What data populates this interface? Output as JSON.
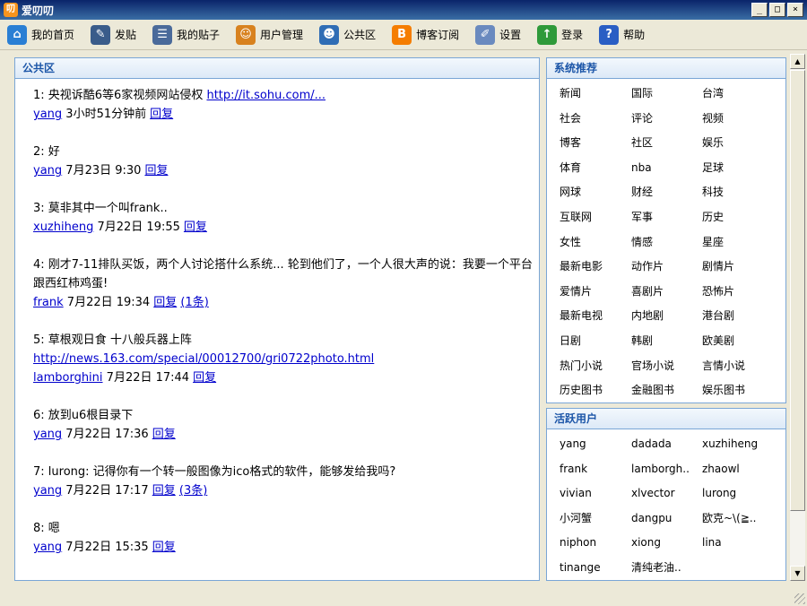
{
  "window": {
    "title": "爱叨叨",
    "logo_text": "叨",
    "min": "_",
    "max": "□",
    "close": "×"
  },
  "toolbar": [
    {
      "id": "home",
      "label": "我的首页",
      "icon": "house-icon",
      "glyph": "⌂",
      "color": "#2a7fd4"
    },
    {
      "id": "post",
      "label": "发贴",
      "icon": "pencil-paper-icon",
      "glyph": "✎",
      "color": "#3a5c8a"
    },
    {
      "id": "myposts",
      "label": "我的贴子",
      "icon": "speech-bubble-icon",
      "glyph": "☰",
      "color": "#4a6a9a"
    },
    {
      "id": "users",
      "label": "用户管理",
      "icon": "users-icon",
      "glyph": "☺",
      "color": "#d8821f"
    },
    {
      "id": "public",
      "label": "公共区",
      "icon": "group-icon",
      "glyph": "☻",
      "color": "#2f6db5"
    },
    {
      "id": "blog",
      "label": "博客订阅",
      "icon": "blogger-icon",
      "glyph": "B",
      "color": "#f57d00"
    },
    {
      "id": "settings",
      "label": "设置",
      "icon": "pen-edit-icon",
      "glyph": "✐",
      "color": "#6a8abf"
    },
    {
      "id": "login",
      "label": "登录",
      "icon": "arrow-up-icon",
      "glyph": "↑",
      "color": "#2f9a3a"
    },
    {
      "id": "help",
      "label": "帮助",
      "icon": "help-icon",
      "glyph": "?",
      "color": "#2a5ec4"
    }
  ],
  "public": {
    "title": "公共区",
    "posts": [
      {
        "text": "1: 央视诉酷6等6家视频网站侵权 ",
        "link": "http://it.sohu.com/...",
        "user": "yang",
        "time": "3小时51分钟前",
        "reply": "回复",
        "replies": ""
      },
      {
        "text": "2: 好",
        "link": "",
        "user": "yang",
        "time": "7月23日 9:30",
        "reply": "回复",
        "replies": ""
      },
      {
        "text": "3: 莫非其中一个叫frank..",
        "link": "",
        "user": "xuzhiheng",
        "time": "7月22日 19:55",
        "reply": "回复",
        "replies": ""
      },
      {
        "text": "4: 刚才7-11排队买饭，两个人讨论搭什么系统... 轮到他们了，一个人很大声的说：我要一个平台跟西红柿鸡蛋!",
        "link": "",
        "user": "frank",
        "time": "7月22日 19:34",
        "reply": "回复",
        "replies": "(1条)"
      },
      {
        "text": "5: 草根观日食 十八般兵器上阵",
        "link": "http://news.163.com/special/00012700/gri0722photo.html",
        "user": "lamborghini",
        "time": "7月22日 17:44",
        "reply": "回复",
        "replies": ""
      },
      {
        "text": "6: 放到u6根目录下",
        "link": "",
        "user": "yang",
        "time": "7月22日 17:36",
        "reply": "回复",
        "replies": ""
      },
      {
        "text": "7: lurong: 记得你有一个转一般图像为ico格式的软件，能够发给我吗?",
        "link": "",
        "user": "yang",
        "time": "7月22日 17:17",
        "reply": "回复",
        "replies": "(3条)"
      },
      {
        "text": "8: 嗯",
        "link": "",
        "user": "yang",
        "time": "7月22日 15:35",
        "reply": "回复",
        "replies": ""
      }
    ]
  },
  "recommend": {
    "title": "系统推荐",
    "items": [
      "新闻",
      "国际",
      "台湾",
      "社会",
      "评论",
      "视频",
      "博客",
      "社区",
      "娱乐",
      "体育",
      "nba",
      "足球",
      "网球",
      "财经",
      "科技",
      "互联网",
      "军事",
      "历史",
      "女性",
      "情感",
      "星座",
      "最新电影",
      "动作片",
      "剧情片",
      "爱情片",
      "喜剧片",
      "恐怖片",
      "最新电视",
      "内地剧",
      "港台剧",
      "日剧",
      "韩剧",
      "欧美剧",
      "热门小说",
      "官场小说",
      "言情小说",
      "历史图书",
      "金融图书",
      "娱乐图书"
    ]
  },
  "active_users": {
    "title": "活跃用户",
    "items": [
      "yang",
      "dadada",
      "xuzhiheng",
      "frank",
      "lamborgh..",
      "zhaowl",
      "vivian",
      "xlvector",
      "lurong",
      "小河蟹",
      "dangpu",
      "欧克~\\(≧..",
      "niphon",
      "xiong",
      "lina",
      "tinange",
      "清纯老油..",
      ""
    ]
  },
  "scrollbar": {
    "up": "▲",
    "down": "▼"
  }
}
